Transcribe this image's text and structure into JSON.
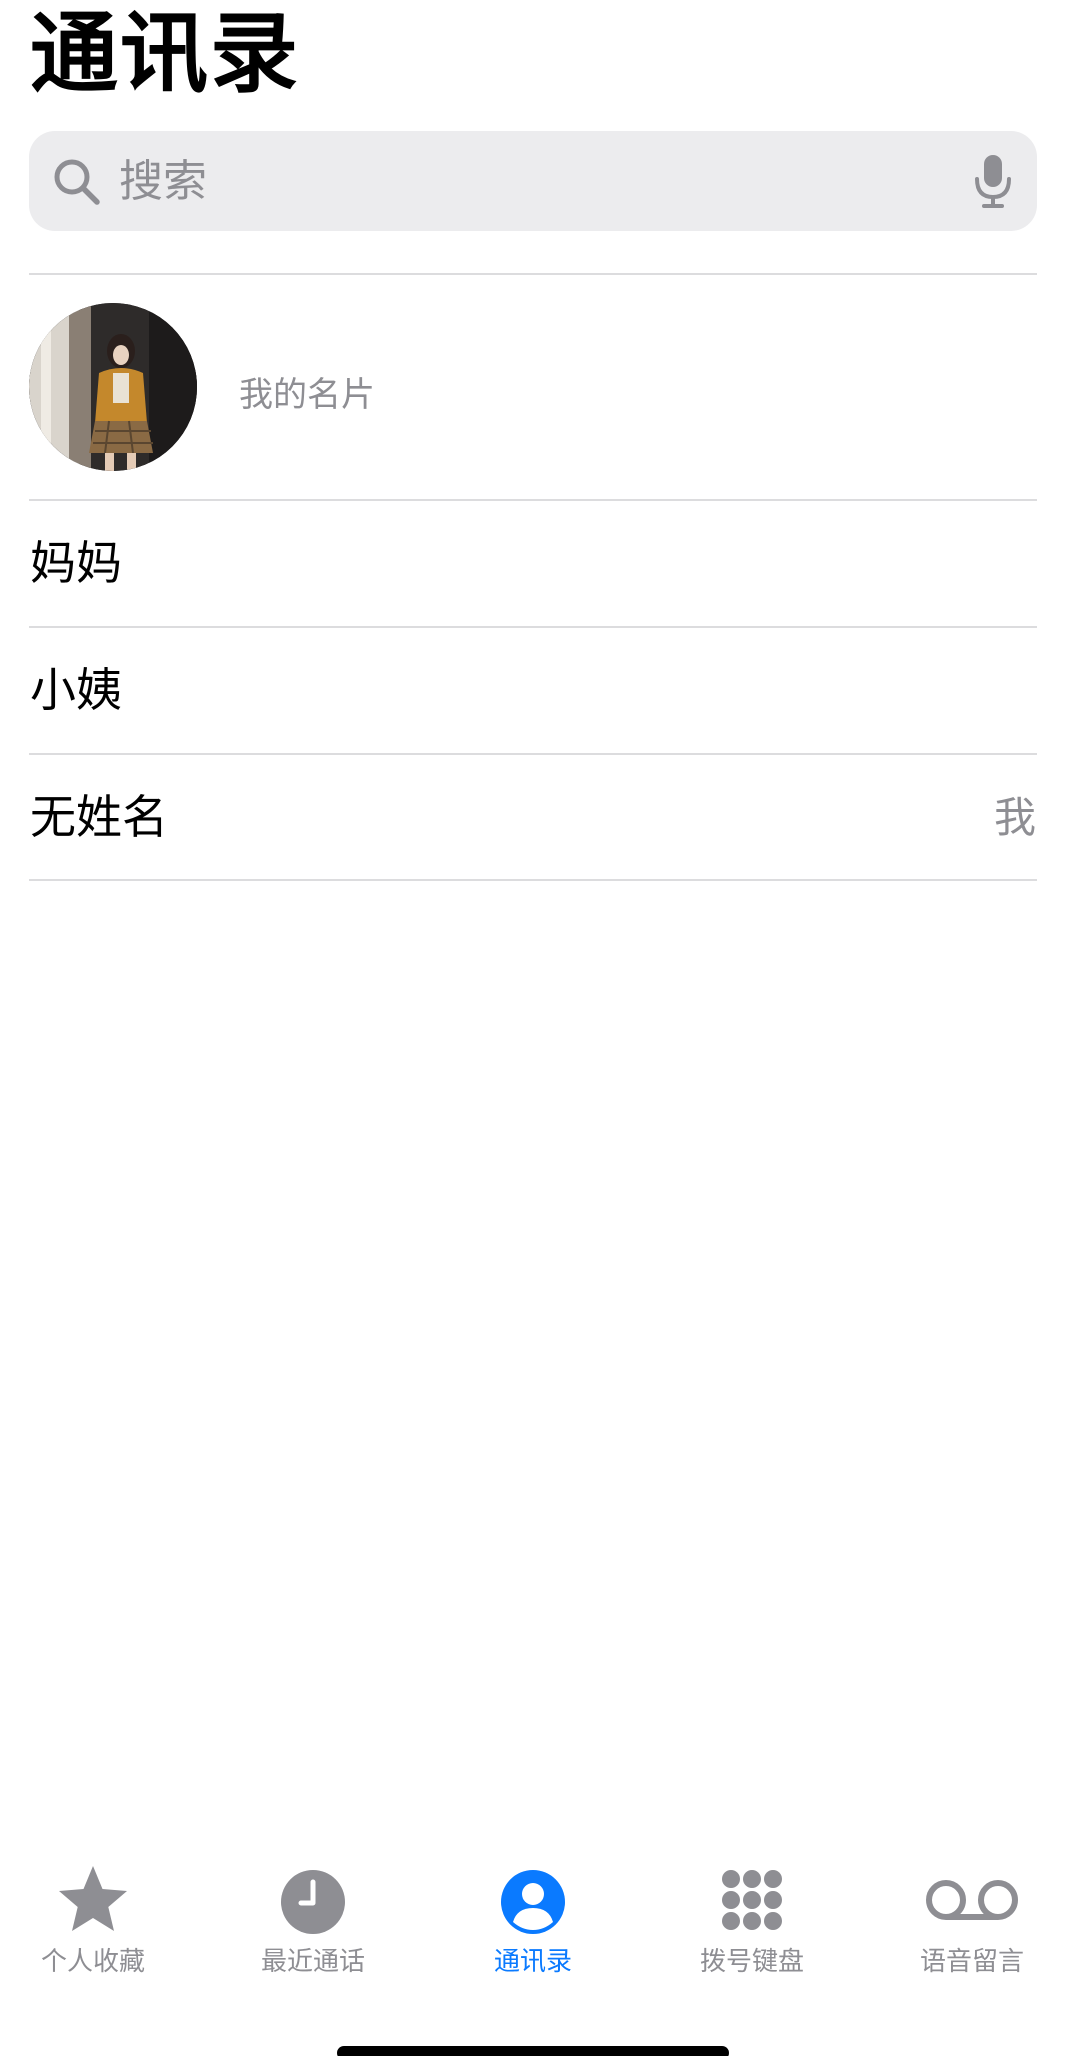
{
  "header": {
    "title": "通讯录"
  },
  "search": {
    "placeholder": "搜索"
  },
  "my_card": {
    "label": "我的名片"
  },
  "contacts": [
    {
      "name": "妈妈",
      "tag": ""
    },
    {
      "name": "小姨",
      "tag": ""
    },
    {
      "name": "无姓名",
      "tag": "我"
    }
  ],
  "tabs": [
    {
      "label": "个人收藏",
      "icon": "star-icon",
      "active": false
    },
    {
      "label": "最近通话",
      "icon": "clock-icon",
      "active": false
    },
    {
      "label": "通讯录",
      "icon": "person-circle-icon",
      "active": true
    },
    {
      "label": "拨号键盘",
      "icon": "keypad-icon",
      "active": false
    },
    {
      "label": "语音留言",
      "icon": "voicemail-icon",
      "active": false
    }
  ],
  "colors": {
    "accent": "#0a7aff",
    "inactive": "#8e8e93",
    "search_bg": "#ececee",
    "divider": "#dcdcde"
  }
}
